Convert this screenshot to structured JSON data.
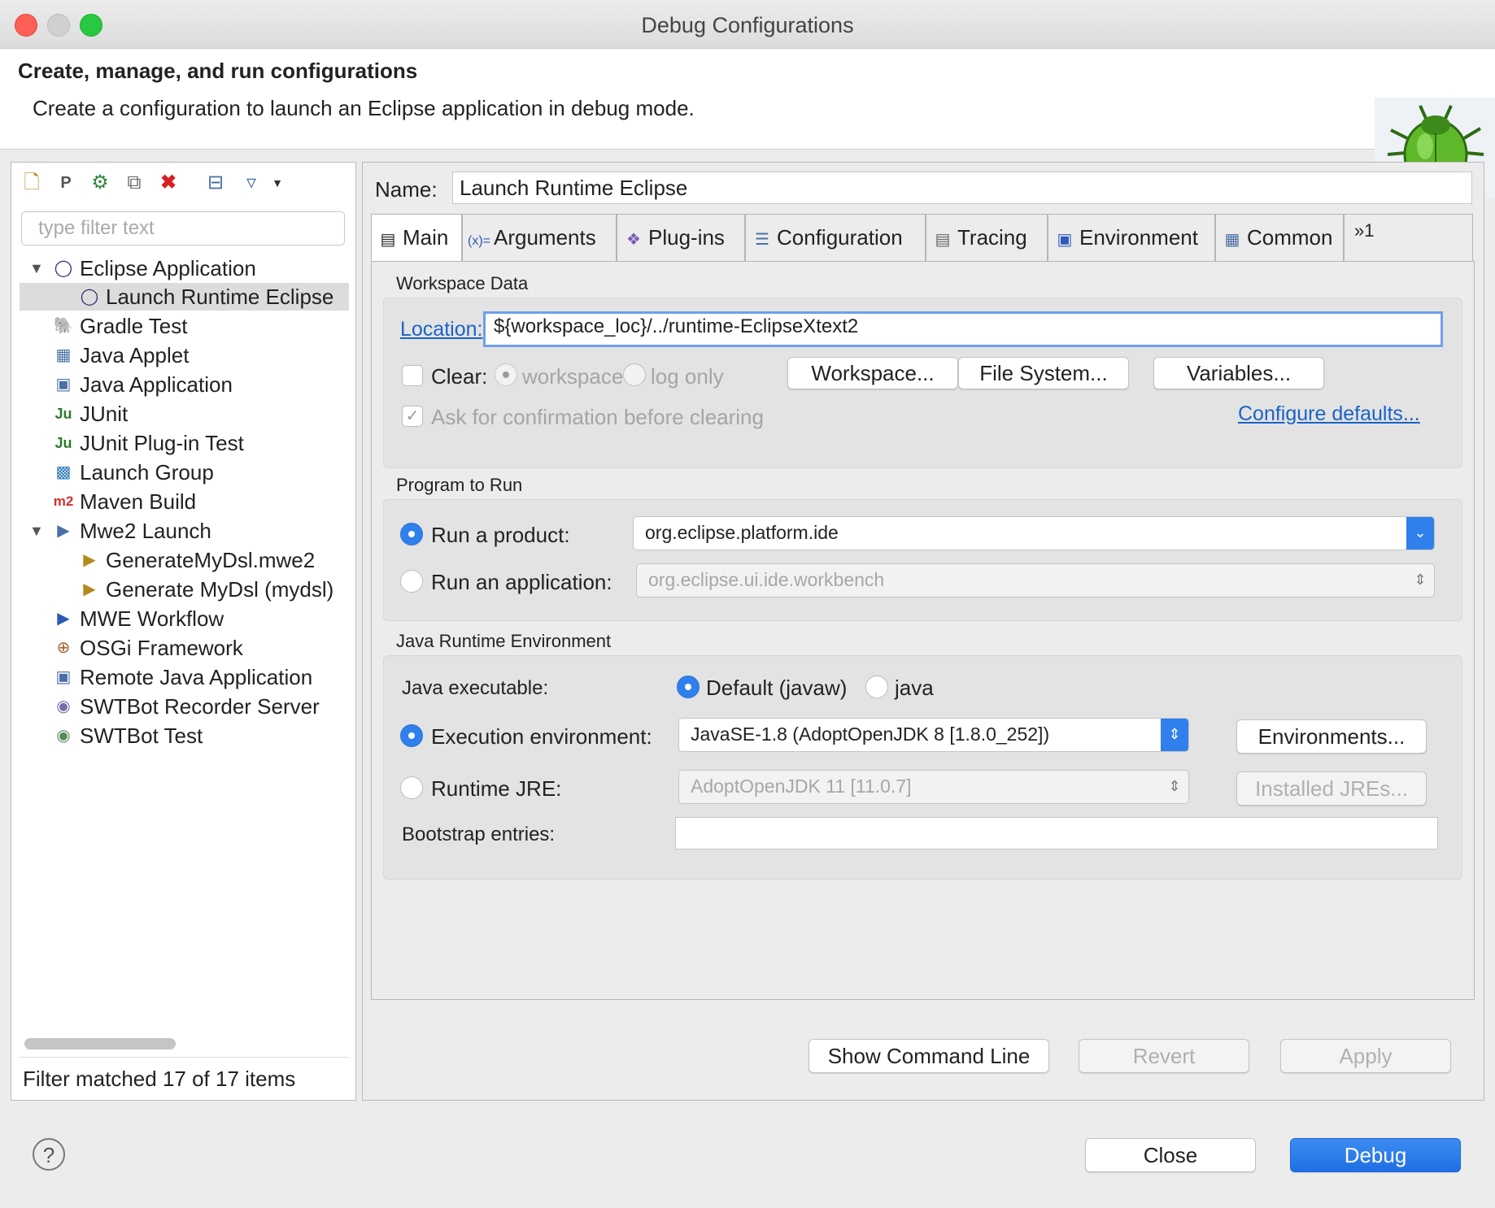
{
  "window": {
    "title": "Debug Configurations"
  },
  "header": {
    "title": "Create, manage, and run configurations",
    "description": "Create a configuration to launch an Eclipse application in debug mode."
  },
  "left": {
    "filter_placeholder": "type filter text",
    "tree": [
      {
        "label": "Eclipse Application",
        "icon": "eclipse-icon",
        "expanded": true
      },
      {
        "label": "Launch Runtime Eclipse",
        "icon": "eclipse-icon",
        "selected": true
      },
      {
        "label": "Gradle Test",
        "icon": "gradle-icon"
      },
      {
        "label": "Java Applet",
        "icon": "java-applet-icon"
      },
      {
        "label": "Java Application",
        "icon": "java-application-icon"
      },
      {
        "label": "JUnit",
        "icon": "junit-icon"
      },
      {
        "label": "JUnit Plug-in Test",
        "icon": "junit-plugin-icon"
      },
      {
        "label": "Launch Group",
        "icon": "launch-group-icon"
      },
      {
        "label": "Maven Build",
        "icon": "maven-icon"
      },
      {
        "label": "Mwe2 Launch",
        "icon": "mwe2-icon",
        "expanded": true
      },
      {
        "label": "GenerateMyDsl.mwe2",
        "icon": "mwe2-file-icon"
      },
      {
        "label": "Generate MyDsl (mydsl)",
        "icon": "mwe2-file-icon"
      },
      {
        "label": "MWE Workflow",
        "icon": "mwe-workflow-icon"
      },
      {
        "label": "OSGi Framework",
        "icon": "osgi-icon"
      },
      {
        "label": "Remote Java Application",
        "icon": "remote-java-icon"
      },
      {
        "label": "SWTBot Recorder Server",
        "icon": "swtbot-recorder-icon"
      },
      {
        "label": "SWTBot Test",
        "icon": "swtbot-test-icon"
      }
    ],
    "status": "Filter matched 17 of 17 items"
  },
  "config": {
    "name_label": "Name:",
    "name_value": "Launch Runtime Eclipse",
    "tabs": [
      "Main",
      "Arguments",
      "Plug-ins",
      "Configuration",
      "Tracing",
      "Environment",
      "Common"
    ],
    "more_tabs": "»1",
    "workspace": {
      "title": "Workspace Data",
      "location_label": "Location:",
      "location_value": "${workspace_loc}/../runtime-EclipseXtext2",
      "clear_label": "Clear:",
      "clear_checked": false,
      "opt_workspace": "workspace",
      "opt_log_only": "log only",
      "btn_workspace": "Workspace...",
      "btn_filesystem": "File System...",
      "btn_variables": "Variables...",
      "ask_confirm": "Ask for confirmation before clearing",
      "configure_defaults": "Configure defaults..."
    },
    "program": {
      "title": "Program to Run",
      "run_product_label": "Run a product:",
      "run_product_value": "org.eclipse.platform.ide",
      "run_app_label": "Run an application:",
      "run_app_value": "org.eclipse.ui.ide.workbench"
    },
    "jre": {
      "title": "Java Runtime Environment",
      "java_exec_label": "Java executable:",
      "opt_default": "Default (javaw)",
      "opt_java": "java",
      "exec_env_label": "Execution environment:",
      "exec_env_value": "JavaSE-1.8 (AdoptOpenJDK 8 [1.8.0_252])",
      "btn_environments": "Environments...",
      "runtime_jre_label": "Runtime JRE:",
      "runtime_jre_value": "AdoptOpenJDK 11 [11.0.7]",
      "btn_installed_jres": "Installed JREs...",
      "bootstrap_label": "Bootstrap entries:",
      "bootstrap_value": ""
    },
    "buttons": {
      "show_cmd": "Show Command Line",
      "revert": "Revert",
      "apply": "Apply"
    }
  },
  "footer": {
    "help": "?",
    "close": "Close",
    "debug": "Debug"
  },
  "colors": {
    "accent": "#2f80ed",
    "link": "#1a63c6",
    "delete": "#d92020"
  }
}
